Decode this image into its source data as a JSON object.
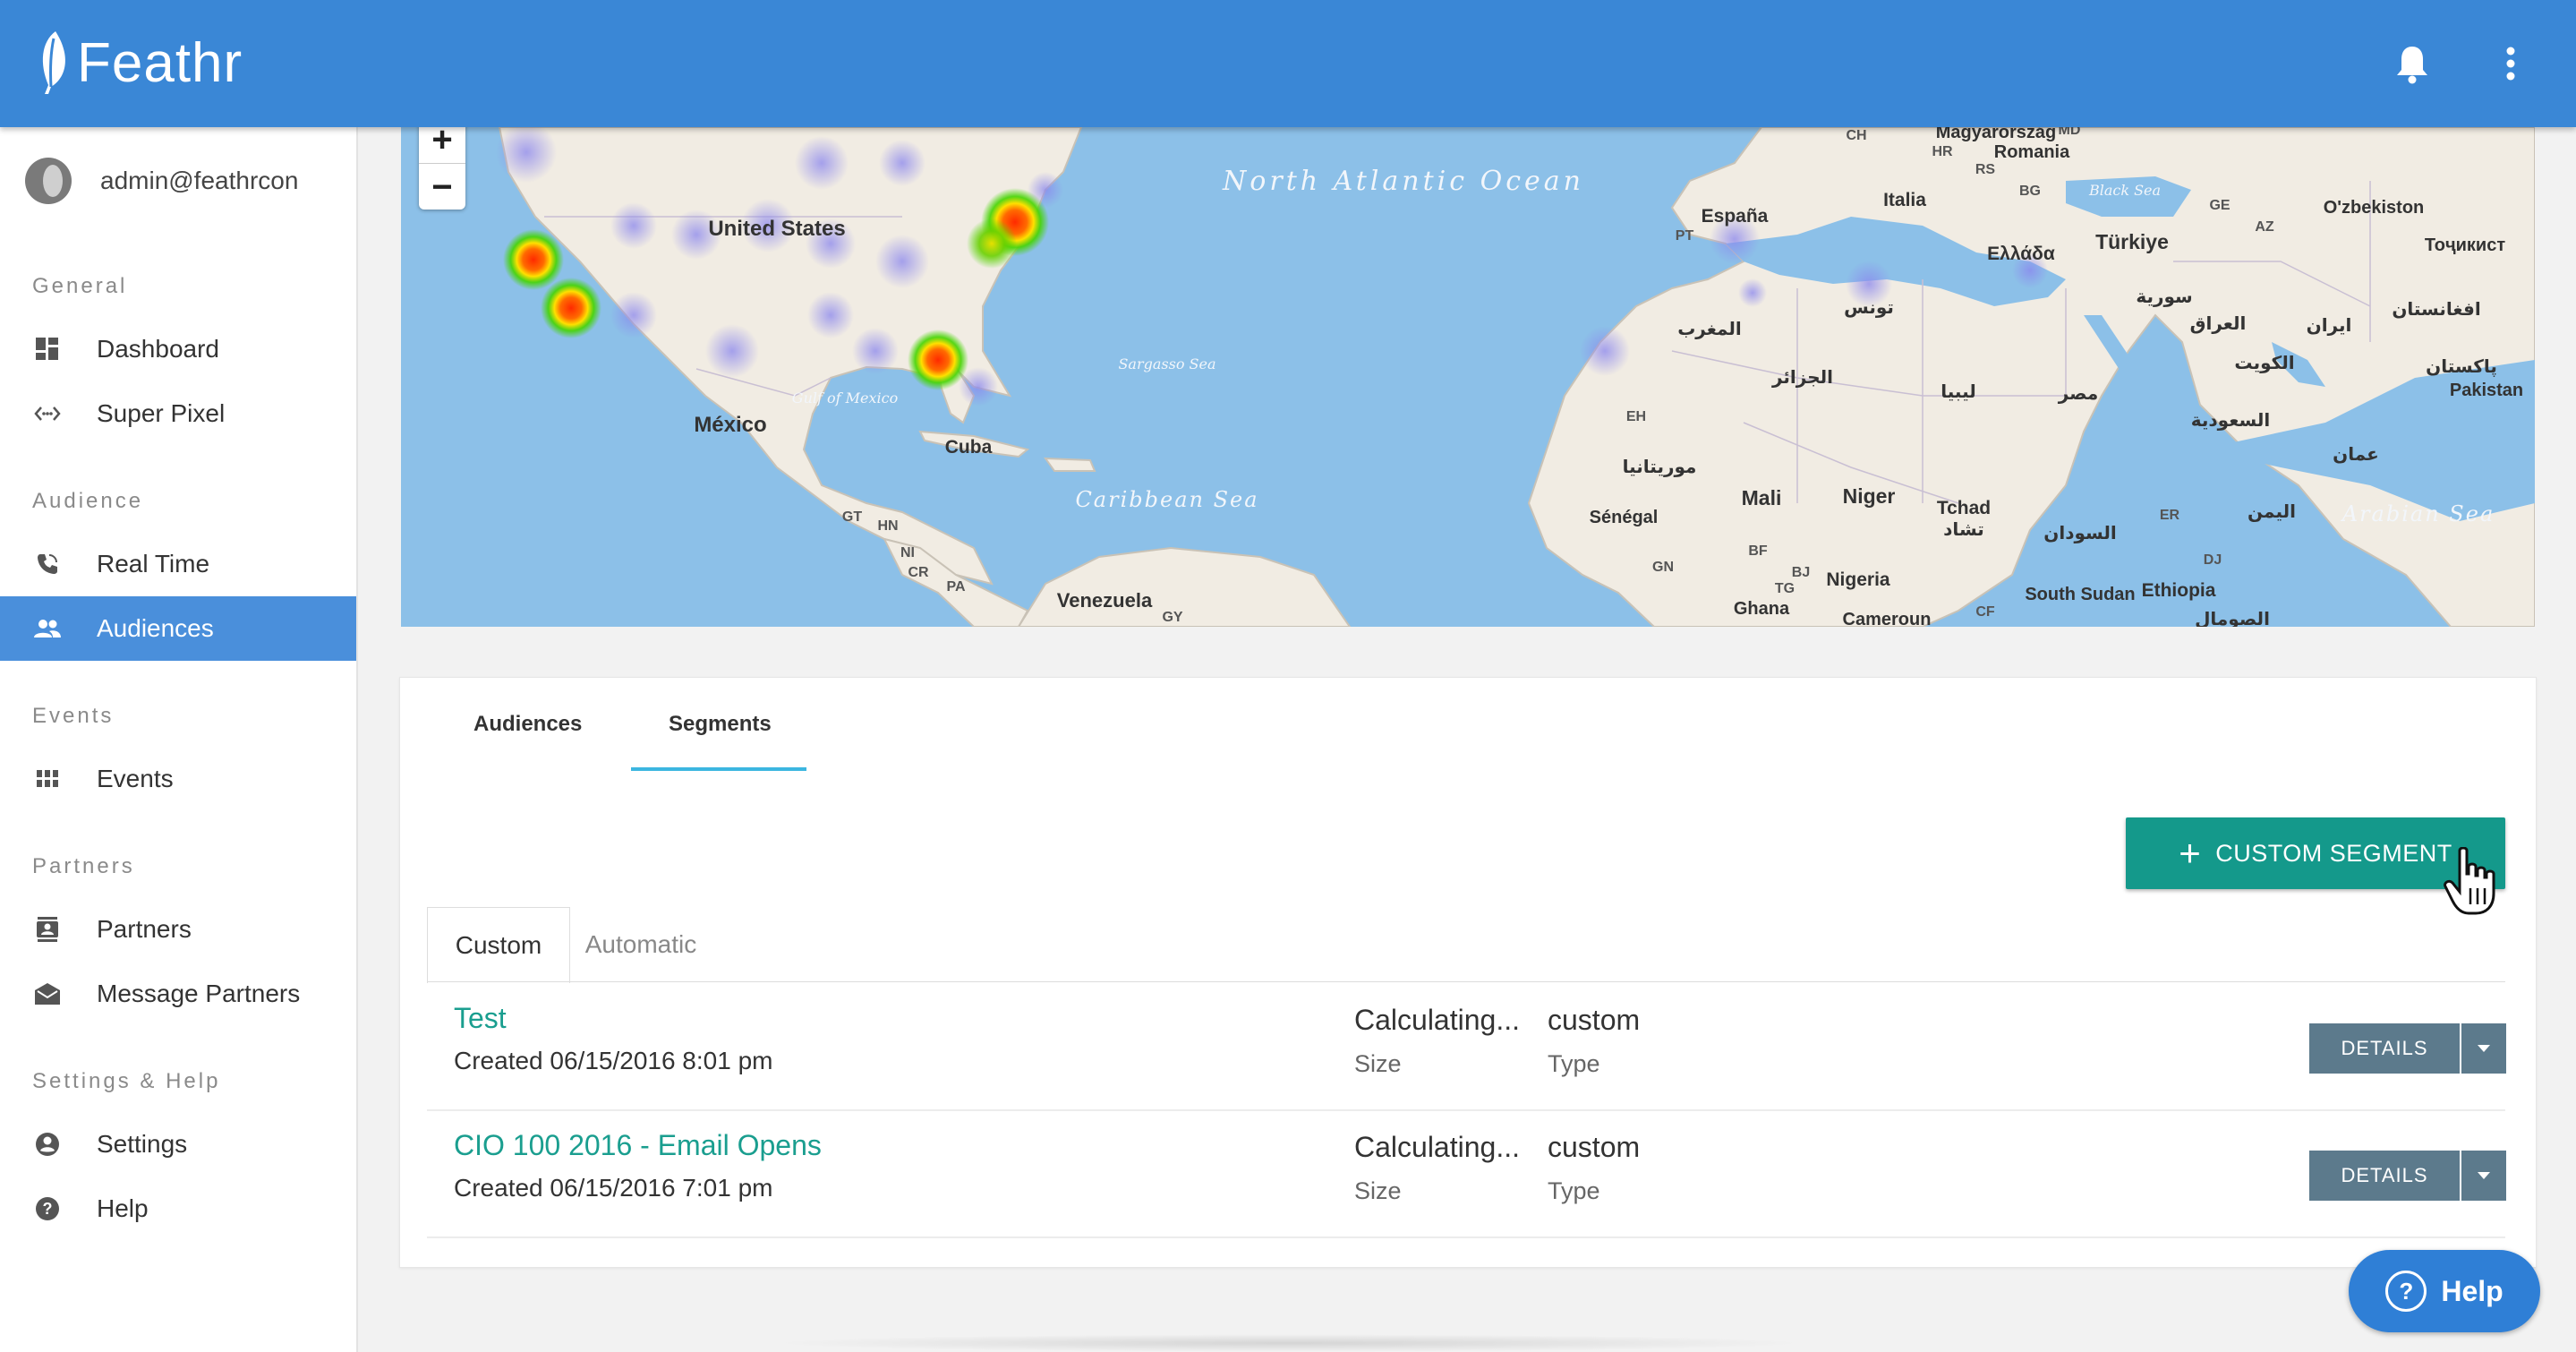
{
  "app": {
    "name": "Feathr"
  },
  "user": {
    "email": "admin@feathrcon"
  },
  "sidebar": {
    "sections": [
      {
        "title": "General",
        "items": [
          {
            "label": "Dashboard",
            "icon": "dashboard-icon"
          },
          {
            "label": "Super Pixel",
            "icon": "code-icon"
          }
        ]
      },
      {
        "title": "Audience",
        "items": [
          {
            "label": "Real Time",
            "icon": "phone-icon"
          },
          {
            "label": "Audiences",
            "icon": "people-icon",
            "active": true
          }
        ]
      },
      {
        "title": "Events",
        "items": [
          {
            "label": "Events",
            "icon": "grid-icon"
          }
        ]
      },
      {
        "title": "Partners",
        "items": [
          {
            "label": "Partners",
            "icon": "contact-card-icon"
          },
          {
            "label": "Message Partners",
            "icon": "mail-icon"
          }
        ]
      },
      {
        "title": "Settings & Help",
        "items": [
          {
            "label": "Settings",
            "icon": "account-circle-icon"
          },
          {
            "label": "Help",
            "icon": "help-circle-icon"
          }
        ]
      }
    ]
  },
  "map": {
    "zoom_in": "+",
    "zoom_out": "−",
    "labels": {
      "us": "United States",
      "mexico": "México",
      "north_atlantic": "North Atlantic Ocean",
      "gulf": "Gulf of Mexico",
      "sargasso": "Sargasso Sea",
      "caribbean": "Caribbean Sea",
      "cuba": "Cuba",
      "venezuela": "Venezuela",
      "espana": "España",
      "italia": "Italia",
      "turkiye": "Türkiye",
      "ellada": "Ελλάδα",
      "magyarorszag": "Magyarország",
      "romania": "Romania",
      "uzbekistan": "O'zbekiston",
      "toshkent": "Тоҷикист",
      "pakistan": "Pakistan",
      "mali": "Mali",
      "niger": "Niger",
      "tchad": "Tchad",
      "senegal": "Sénégal",
      "nigeria": "Nigeria",
      "ghana": "Ghana",
      "cameroun": "Cameroun",
      "ethiopia": "Ethiopia",
      "south_sudan": "South Sudan",
      "arabian_sea": "Arabian Sea",
      "black_sea": "Black Sea",
      "gt": "GT",
      "hn": "HN",
      "ni": "NI",
      "cr": "CR",
      "pa": "PA",
      "gy": "GY",
      "eh": "EH",
      "gn": "GN",
      "bf": "BF",
      "bj": "BJ",
      "tg": "TG",
      "cf": "CF",
      "er": "ER",
      "dj": "DJ",
      "pt": "PT",
      "ch": "CH",
      "hr": "HR",
      "rs": "RS",
      "bg": "BG",
      "md": "MD",
      "ge": "GE",
      "az": "AZ",
      "jazair": "الجزائر",
      "maghrib": "المغرب",
      "tunis": "تونس",
      "libya": "ليبيا",
      "misr": "مصر",
      "sudan": "السودان",
      "saudi": "السعودية",
      "iraq": "العراق",
      "suriya": "سورية",
      "iran": "ایران",
      "afghanistan": "افغانستان",
      "pakistan_ar": "پاکستان",
      "kuwait": "الكويت",
      "oman": "عمان",
      "yemen": "اليمن",
      "mauritania": "موريتانيا",
      "tchad_ar": "تشاد",
      "somalia": "الصومال"
    }
  },
  "tabs": {
    "audiences": "Audiences",
    "segments": "Segments"
  },
  "custom_segment_button": "CUSTOM SEGMENT",
  "subtabs": {
    "custom": "Custom",
    "automatic": "Automatic"
  },
  "segments": [
    {
      "name": "Test",
      "created": "Created 06/15/2016 8:01 pm",
      "size": "Calculating...",
      "size_label": "Size",
      "type": "custom",
      "type_label": "Type",
      "action": "DETAILS"
    },
    {
      "name": "CIO 100 2016 - Email Opens",
      "created": "Created 06/15/2016 7:01 pm",
      "size": "Calculating...",
      "size_label": "Size",
      "type": "custom",
      "type_label": "Type",
      "action": "DETAILS"
    }
  ],
  "help_fab": {
    "q": "?",
    "label": "Help"
  }
}
